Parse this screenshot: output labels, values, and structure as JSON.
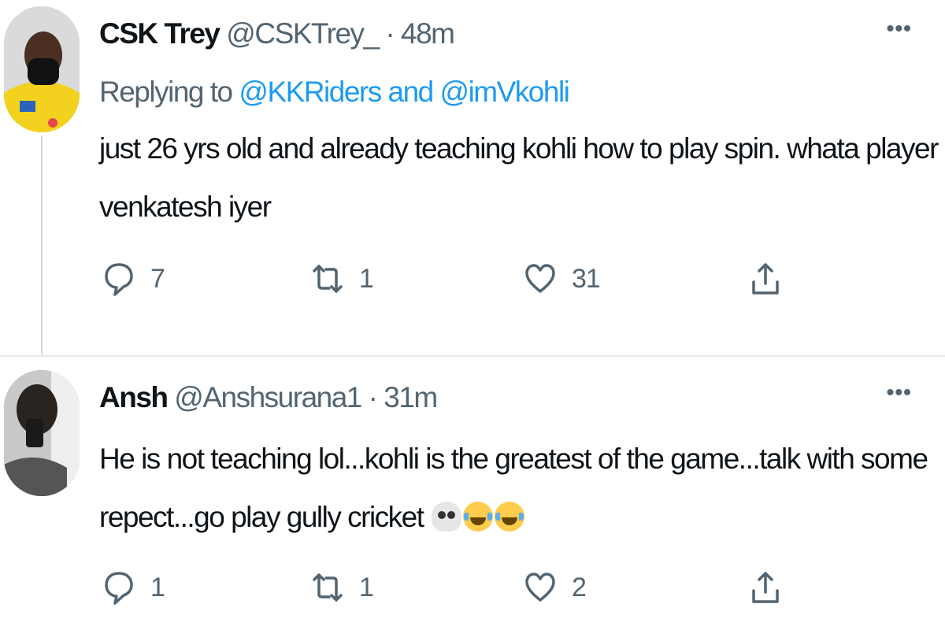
{
  "tweets": [
    {
      "name": "CSK Trey",
      "handle": "@CSKTrey_",
      "sep": "·",
      "time": "48m",
      "replying_prefix": "Replying to ",
      "replying_to": "@KKRiders and @imVkohli",
      "text_line1": "just 26 yrs old and already teaching kohli how to play spin. whata player",
      "text_line2": "venkatesh iyer",
      "reply_count": "7",
      "retweet_count": "1",
      "like_count": "31"
    },
    {
      "name": "Ansh",
      "handle": "@Anshsurana1",
      "sep": "·",
      "time": "31m",
      "text_line1": "He is not teaching lol...kohli is the greatest of the game...talk with some",
      "text_line2": "repect...go play gully cricket",
      "emojis": [
        "skull-emoji",
        "joy-emoji",
        "joy-emoji"
      ],
      "reply_count": "1",
      "retweet_count": "1",
      "like_count": "2"
    }
  ],
  "icons": {
    "more": "more-horizontal-icon",
    "reply": "reply-bubble-icon",
    "retweet": "retweet-icon",
    "like": "heart-icon",
    "share": "share-icon"
  },
  "colors": {
    "link": "#1d9bf0",
    "secondary_text": "#536471",
    "primary_text": "#0f1419"
  }
}
